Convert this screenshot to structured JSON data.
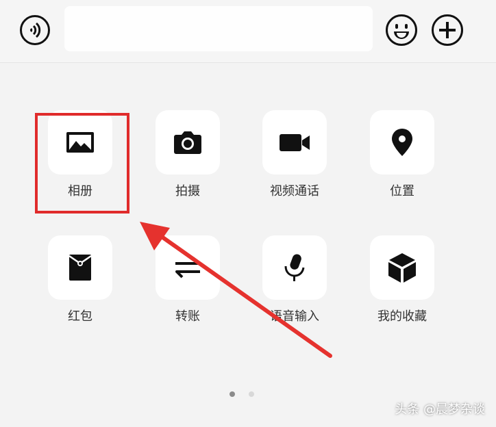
{
  "panel": {
    "items": [
      {
        "label": "相册",
        "icon": "photo-album-icon"
      },
      {
        "label": "拍摄",
        "icon": "camera-icon"
      },
      {
        "label": "视频通话",
        "icon": "video-call-icon"
      },
      {
        "label": "位置",
        "icon": "location-pin-icon"
      },
      {
        "label": "红包",
        "icon": "red-packet-icon"
      },
      {
        "label": "转账",
        "icon": "transfer-icon"
      },
      {
        "label": "语音输入",
        "icon": "microphone-icon"
      },
      {
        "label": "我的收藏",
        "icon": "favorites-cube-icon"
      }
    ],
    "page_indicator": {
      "current": 1,
      "total": 2
    }
  },
  "annotation": {
    "highlight_color": "#e02b2b"
  },
  "watermark": "头条 @晨梦杂谈"
}
